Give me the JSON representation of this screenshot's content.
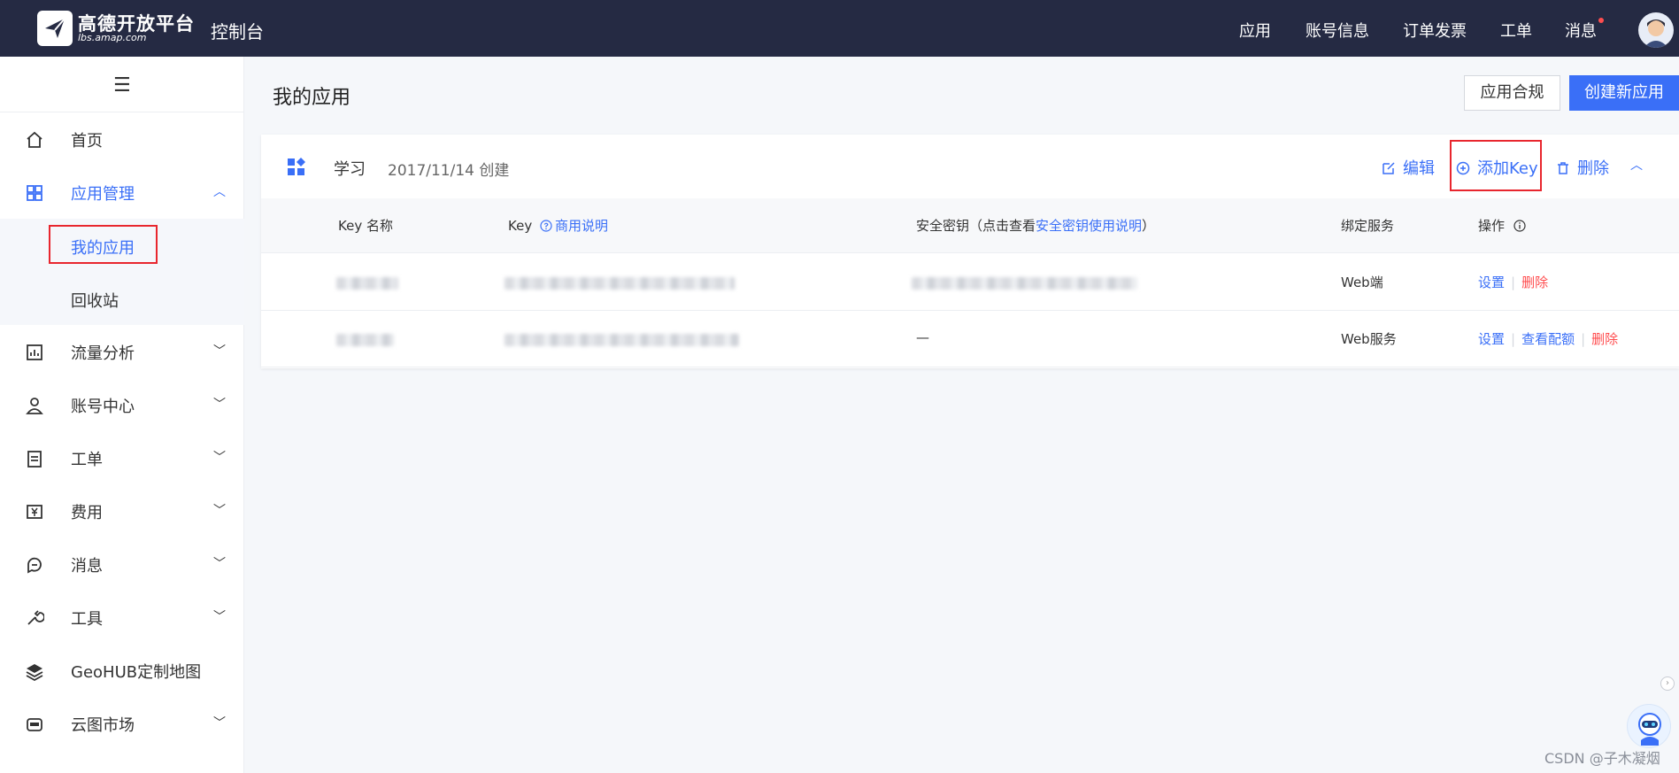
{
  "topbar": {
    "logo_title": "高德开放平台",
    "logo_subtitle": "lbs.amap.com",
    "console": "控制台",
    "nav": [
      "应用",
      "账号信息",
      "订单发票",
      "工单",
      "消息"
    ]
  },
  "sidebar": {
    "items": [
      {
        "label": "首页",
        "icon": "home-icon"
      },
      {
        "label": "应用管理",
        "icon": "grid-icon",
        "expanded": true
      },
      {
        "label": "流量分析",
        "icon": "chart-icon"
      },
      {
        "label": "账号中心",
        "icon": "user-icon"
      },
      {
        "label": "工单",
        "icon": "clipboard-icon"
      },
      {
        "label": "费用",
        "icon": "yuan-icon"
      },
      {
        "label": "消息",
        "icon": "chat-icon"
      },
      {
        "label": "工具",
        "icon": "wrench-icon"
      },
      {
        "label": "GeoHUB定制地图",
        "icon": "layers-icon"
      },
      {
        "label": "云图市场",
        "icon": "box-icon"
      }
    ],
    "sub_items": [
      "我的应用",
      "回收站"
    ]
  },
  "main": {
    "title": "我的应用",
    "btn_compliance": "应用合规",
    "btn_create": "创建新应用"
  },
  "app": {
    "name": "学习",
    "created": "2017/11/14 创建",
    "actions": {
      "edit": "编辑",
      "add_key": "添加Key",
      "delete": "删除"
    },
    "columns": {
      "key_name": "Key 名称",
      "key": "Key",
      "key_link": "商用说明",
      "secret_prefix": "安全密钥（点击查看",
      "secret_link": "安全密钥使用说明",
      "secret_suffix": "）",
      "service": "绑定服务",
      "ops": "操作"
    },
    "rows": [
      {
        "secret": "",
        "service": "Web端",
        "ops": [
          "设置",
          "删除"
        ]
      },
      {
        "secret": "—",
        "service": "Web服务",
        "ops": [
          "设置",
          "查看配额",
          "删除"
        ]
      }
    ]
  },
  "watermark": "CSDN @子木凝烟",
  "colors": {
    "topbar": "#252a43",
    "accent": "#3a6ff7",
    "danger": "#ff4d4f",
    "highlight_box": "#e8262e"
  }
}
